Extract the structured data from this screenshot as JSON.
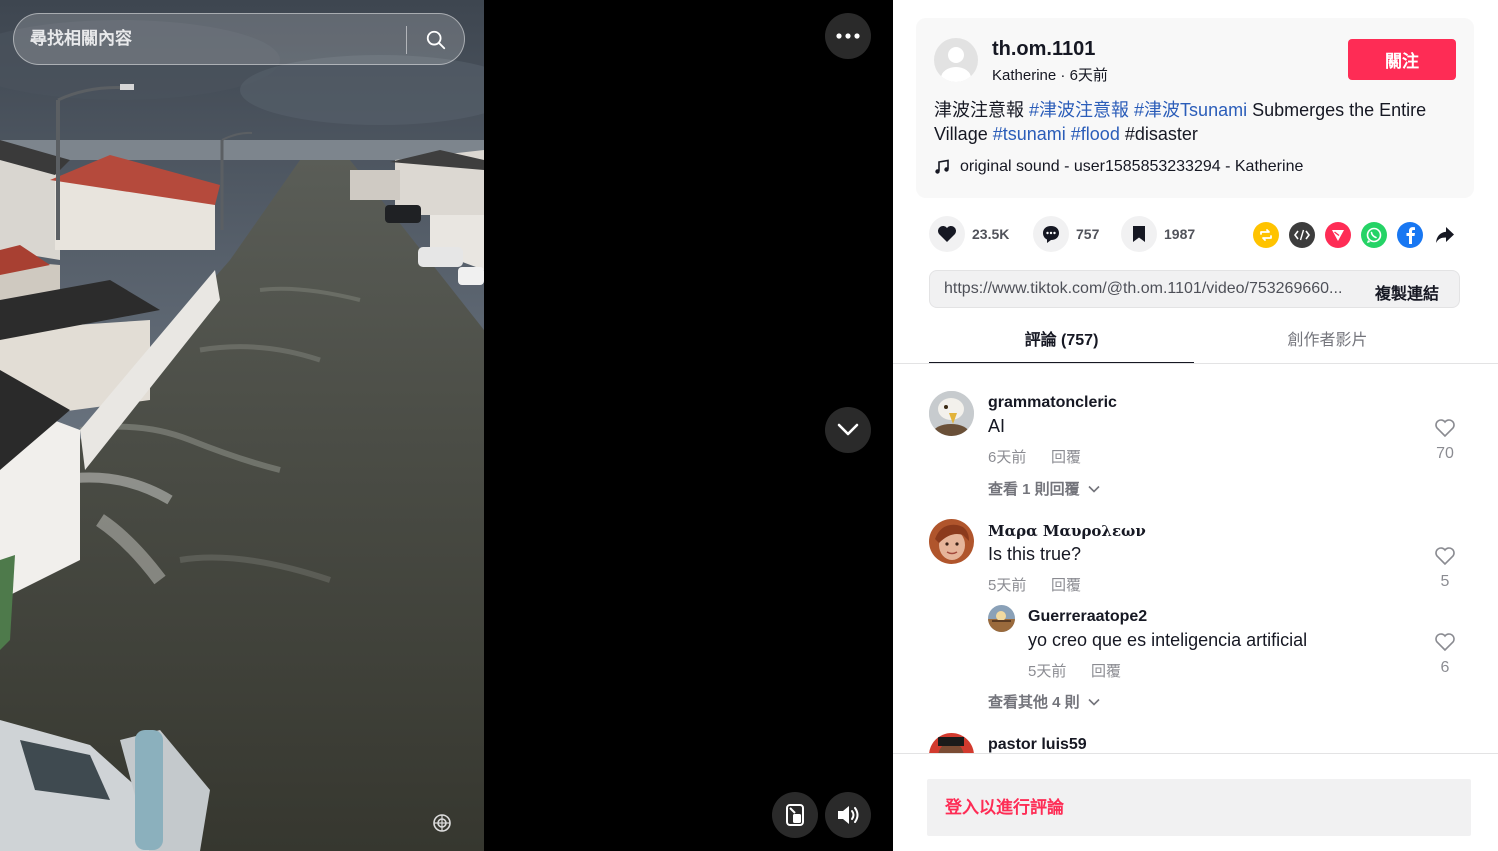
{
  "search": {
    "placeholder": "尋找相關內容"
  },
  "author": {
    "username": "th.om.1101",
    "nickname": "Katherine",
    "separator": " · ",
    "posted": "6天前",
    "follow_label": "關注"
  },
  "description": {
    "lead": "津波注意報 ",
    "tag1": "#津波注意報",
    "tag2": "#津波Tsunami",
    "mid": " Submerges the Entire Village ",
    "tag3": "#tsunami",
    "tag4": "#flood",
    "tail": " #disaster"
  },
  "music": {
    "text": "original sound - user1585853233294 - Katherine",
    "icon": "music-note-icon"
  },
  "actions": {
    "likes": "23.5K",
    "comments": "757",
    "saves": "1987"
  },
  "share_icons": [
    "repost-icon",
    "embed-icon",
    "send-icon",
    "whatsapp-icon",
    "facebook-icon",
    "share-arrow-icon"
  ],
  "colors": {
    "accent": "#fe2c55",
    "hashtag": "#2b5db9",
    "repost": "#ffc300",
    "send": "#fe2c55",
    "whatsapp": "#25d366",
    "facebook": "#1877f2",
    "embed": "#3d3d3d"
  },
  "link": {
    "url": "https://www.tiktok.com/@th.om.1101/video/753269660...",
    "copy_label": "複製連結"
  },
  "tabs": {
    "comments": "評論 (757)",
    "creator": "創作者影片"
  },
  "comments": [
    {
      "user": "grammatoncleric",
      "text": "AI",
      "time": "6天前",
      "reply": "回覆",
      "likes": "70",
      "more": "查看 1 則回覆"
    },
    {
      "user": "Μαρα Μαυρολεων",
      "text": "Is this true?",
      "time": "5天前",
      "reply": "回覆",
      "likes": "5",
      "sub": {
        "user": "Guerreraatope2",
        "text": "yo creo que es inteligencia artificial",
        "time": "5天前",
        "reply": "回覆",
        "likes": "6"
      },
      "more": "查看其他 4 則"
    },
    {
      "user": "pastor luis59"
    }
  ],
  "login": {
    "label": "登入以進行評論"
  }
}
